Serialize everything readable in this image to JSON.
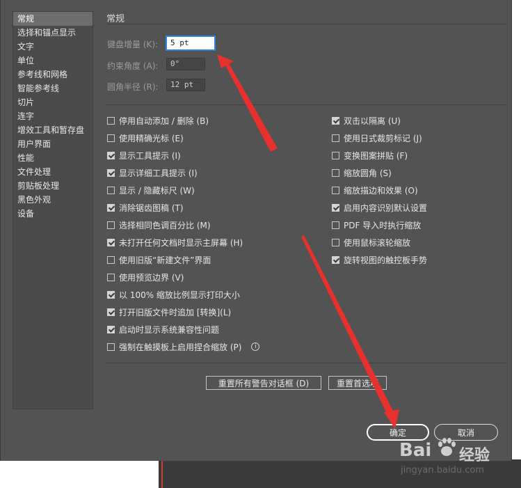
{
  "sidebar": {
    "items": [
      {
        "label": "常规",
        "active": true
      },
      {
        "label": "选择和锚点显示"
      },
      {
        "label": "文字"
      },
      {
        "label": "单位"
      },
      {
        "label": "参考线和网格"
      },
      {
        "label": "智能参考线"
      },
      {
        "label": "切片"
      },
      {
        "label": "连字"
      },
      {
        "label": "增效工具和暂存盘"
      },
      {
        "label": "用户界面"
      },
      {
        "label": "性能"
      },
      {
        "label": "文件处理"
      },
      {
        "label": "剪贴板处理"
      },
      {
        "label": "黑色外观"
      },
      {
        "label": "设备"
      }
    ]
  },
  "main": {
    "section_title": "常规",
    "fields": {
      "keyboard_increment": {
        "label": "键盘增量 (K):",
        "value": "5 pt"
      },
      "constrain_angle": {
        "label": "约束角度 (A):",
        "value": "0°"
      },
      "corner_radius": {
        "label": "圆角半径 (R):",
        "value": "12 pt"
      }
    },
    "left_options": [
      {
        "label": "停用自动添加 / 删除 (B)",
        "checked": false
      },
      {
        "label": "使用精确光标 (E)",
        "checked": false
      },
      {
        "label": "显示工具提示 (I)",
        "checked": true
      },
      {
        "label": "显示详细工具提示 (I)",
        "checked": true
      },
      {
        "label": "显示 / 隐藏标尺 (W)",
        "checked": false
      },
      {
        "label": "消除锯齿图稿 (T)",
        "checked": true
      },
      {
        "label": "选择相同色调百分比 (M)",
        "checked": false
      },
      {
        "label": "未打开任何文档时显示主屏幕 (H)",
        "checked": true
      },
      {
        "label": "使用旧版“新建文件”界面",
        "checked": false
      },
      {
        "label": "使用预览边界 (V)",
        "checked": false
      },
      {
        "label": "以 100% 缩放比例显示打印大小",
        "checked": true
      },
      {
        "label": "打开旧版文件时追加 [转换](L)",
        "checked": true
      },
      {
        "label": "启动时显示系统兼容性问题",
        "checked": true
      },
      {
        "label": "强制在触摸板上启用捏合缩放 (P)",
        "checked": false
      }
    ],
    "right_options": [
      {
        "label": "双击以隔离 (U)",
        "checked": true
      },
      {
        "label": "使用日式裁剪标记 (J)",
        "checked": false
      },
      {
        "label": "变换图案拼贴 (F)",
        "checked": false
      },
      {
        "label": "缩放圆角 (S)",
        "checked": false
      },
      {
        "label": "缩放描边和效果 (O)",
        "checked": false
      },
      {
        "label": "启用内容识别默认设置",
        "checked": true
      },
      {
        "label": "PDF 导入时执行缩放",
        "checked": false
      },
      {
        "label": "使用鼠标滚轮缩放",
        "checked": false
      },
      {
        "label": "旋转视图的触控板手势",
        "checked": true
      }
    ],
    "info_icon": "info-icon",
    "reset_warnings_label": "重置所有警告对话框 (D)",
    "reset_prefs_label": "重置首选项"
  },
  "footer": {
    "ok_label": "确定",
    "cancel_label": "取消"
  },
  "watermark": {
    "brand": "Bai",
    "brand_suffix": "经验",
    "url": "jingyan.baidu.com"
  },
  "colors": {
    "dialog_bg": "#535353",
    "sidebar_bg": "#4a4a4a",
    "annotation_arrow": "#e8312c"
  }
}
